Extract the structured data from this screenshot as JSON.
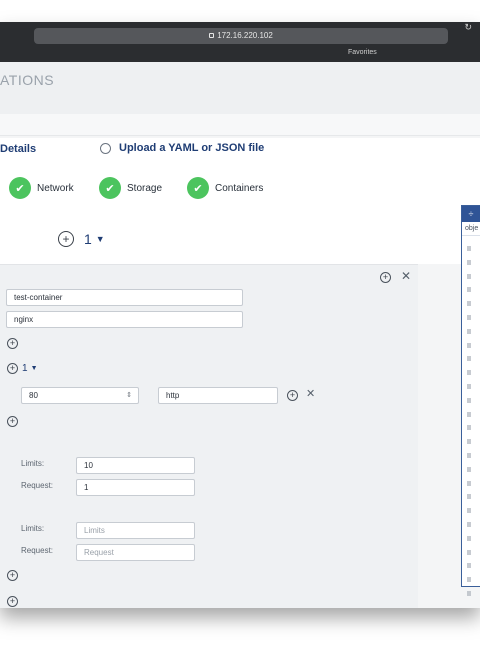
{
  "browser": {
    "address": "172.16.220.102",
    "favorites_label": "Favorites"
  },
  "app": {
    "title": "ATIONS"
  },
  "mode": {
    "details_label": "Details",
    "upload_label": "Upload a YAML or JSON file"
  },
  "steps": [
    {
      "label": "Network"
    },
    {
      "label": "Storage"
    },
    {
      "label": "Containers"
    }
  ],
  "container_count": "1",
  "form": {
    "name_value": "test-container",
    "image_value": "nginx",
    "ports_count": "1",
    "port_value": "80",
    "protocol_value": "http",
    "cpu": {
      "limits_label": "Limits:",
      "limits_value": "10",
      "request_label": "Request:",
      "request_value": "1"
    },
    "memory": {
      "limits_label": "Limits:",
      "limits_placeholder": "Limits",
      "request_label": "Request:",
      "request_placeholder": "Request"
    }
  },
  "side_panel": {
    "header_icon": "÷",
    "row_label": "obje"
  },
  "colors": {
    "accent_blue": "#1f3d74",
    "success_green": "#4cc45e",
    "panel_header": "#2f5496"
  }
}
